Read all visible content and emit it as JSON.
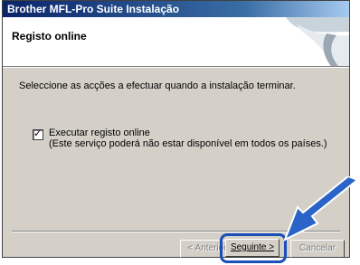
{
  "window": {
    "title": "Brother MFL-Pro Suite Instalação"
  },
  "header": {
    "title": "Registo online"
  },
  "content": {
    "instruction": "Seleccione as acções a efectuar quando a instalação terminar.",
    "checkbox": {
      "checked": true,
      "label_line1": "Executar registo online",
      "label_line2": "(Este serviço poderá não estar disponível em todos os países.)"
    }
  },
  "buttons": {
    "back_label": "< Anterior",
    "next_label": "Seguinte >",
    "cancel_label": "Cancelar"
  },
  "colors": {
    "title_bar": "#0a246a",
    "highlight": "#1a4fb8",
    "dialog_bg": "#d4d0c8"
  },
  "icons": {
    "pointer_arrow": "arrow-pointer-icon",
    "checkmark": "check-icon"
  }
}
